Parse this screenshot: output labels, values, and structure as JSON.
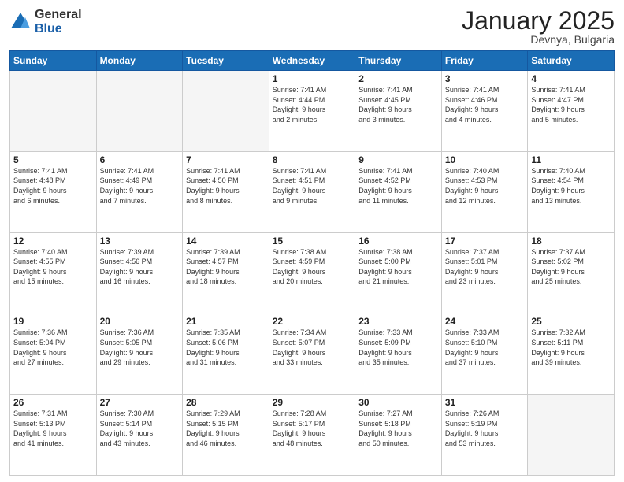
{
  "logo": {
    "general": "General",
    "blue": "Blue"
  },
  "header": {
    "month": "January 2025",
    "location": "Devnya, Bulgaria"
  },
  "weekdays": [
    "Sunday",
    "Monday",
    "Tuesday",
    "Wednesday",
    "Thursday",
    "Friday",
    "Saturday"
  ],
  "weeks": [
    [
      {
        "day": "",
        "info": ""
      },
      {
        "day": "",
        "info": ""
      },
      {
        "day": "",
        "info": ""
      },
      {
        "day": "1",
        "info": "Sunrise: 7:41 AM\nSunset: 4:44 PM\nDaylight: 9 hours\nand 2 minutes."
      },
      {
        "day": "2",
        "info": "Sunrise: 7:41 AM\nSunset: 4:45 PM\nDaylight: 9 hours\nand 3 minutes."
      },
      {
        "day": "3",
        "info": "Sunrise: 7:41 AM\nSunset: 4:46 PM\nDaylight: 9 hours\nand 4 minutes."
      },
      {
        "day": "4",
        "info": "Sunrise: 7:41 AM\nSunset: 4:47 PM\nDaylight: 9 hours\nand 5 minutes."
      }
    ],
    [
      {
        "day": "5",
        "info": "Sunrise: 7:41 AM\nSunset: 4:48 PM\nDaylight: 9 hours\nand 6 minutes."
      },
      {
        "day": "6",
        "info": "Sunrise: 7:41 AM\nSunset: 4:49 PM\nDaylight: 9 hours\nand 7 minutes."
      },
      {
        "day": "7",
        "info": "Sunrise: 7:41 AM\nSunset: 4:50 PM\nDaylight: 9 hours\nand 8 minutes."
      },
      {
        "day": "8",
        "info": "Sunrise: 7:41 AM\nSunset: 4:51 PM\nDaylight: 9 hours\nand 9 minutes."
      },
      {
        "day": "9",
        "info": "Sunrise: 7:41 AM\nSunset: 4:52 PM\nDaylight: 9 hours\nand 11 minutes."
      },
      {
        "day": "10",
        "info": "Sunrise: 7:40 AM\nSunset: 4:53 PM\nDaylight: 9 hours\nand 12 minutes."
      },
      {
        "day": "11",
        "info": "Sunrise: 7:40 AM\nSunset: 4:54 PM\nDaylight: 9 hours\nand 13 minutes."
      }
    ],
    [
      {
        "day": "12",
        "info": "Sunrise: 7:40 AM\nSunset: 4:55 PM\nDaylight: 9 hours\nand 15 minutes."
      },
      {
        "day": "13",
        "info": "Sunrise: 7:39 AM\nSunset: 4:56 PM\nDaylight: 9 hours\nand 16 minutes."
      },
      {
        "day": "14",
        "info": "Sunrise: 7:39 AM\nSunset: 4:57 PM\nDaylight: 9 hours\nand 18 minutes."
      },
      {
        "day": "15",
        "info": "Sunrise: 7:38 AM\nSunset: 4:59 PM\nDaylight: 9 hours\nand 20 minutes."
      },
      {
        "day": "16",
        "info": "Sunrise: 7:38 AM\nSunset: 5:00 PM\nDaylight: 9 hours\nand 21 minutes."
      },
      {
        "day": "17",
        "info": "Sunrise: 7:37 AM\nSunset: 5:01 PM\nDaylight: 9 hours\nand 23 minutes."
      },
      {
        "day": "18",
        "info": "Sunrise: 7:37 AM\nSunset: 5:02 PM\nDaylight: 9 hours\nand 25 minutes."
      }
    ],
    [
      {
        "day": "19",
        "info": "Sunrise: 7:36 AM\nSunset: 5:04 PM\nDaylight: 9 hours\nand 27 minutes."
      },
      {
        "day": "20",
        "info": "Sunrise: 7:36 AM\nSunset: 5:05 PM\nDaylight: 9 hours\nand 29 minutes."
      },
      {
        "day": "21",
        "info": "Sunrise: 7:35 AM\nSunset: 5:06 PM\nDaylight: 9 hours\nand 31 minutes."
      },
      {
        "day": "22",
        "info": "Sunrise: 7:34 AM\nSunset: 5:07 PM\nDaylight: 9 hours\nand 33 minutes."
      },
      {
        "day": "23",
        "info": "Sunrise: 7:33 AM\nSunset: 5:09 PM\nDaylight: 9 hours\nand 35 minutes."
      },
      {
        "day": "24",
        "info": "Sunrise: 7:33 AM\nSunset: 5:10 PM\nDaylight: 9 hours\nand 37 minutes."
      },
      {
        "day": "25",
        "info": "Sunrise: 7:32 AM\nSunset: 5:11 PM\nDaylight: 9 hours\nand 39 minutes."
      }
    ],
    [
      {
        "day": "26",
        "info": "Sunrise: 7:31 AM\nSunset: 5:13 PM\nDaylight: 9 hours\nand 41 minutes."
      },
      {
        "day": "27",
        "info": "Sunrise: 7:30 AM\nSunset: 5:14 PM\nDaylight: 9 hours\nand 43 minutes."
      },
      {
        "day": "28",
        "info": "Sunrise: 7:29 AM\nSunset: 5:15 PM\nDaylight: 9 hours\nand 46 minutes."
      },
      {
        "day": "29",
        "info": "Sunrise: 7:28 AM\nSunset: 5:17 PM\nDaylight: 9 hours\nand 48 minutes."
      },
      {
        "day": "30",
        "info": "Sunrise: 7:27 AM\nSunset: 5:18 PM\nDaylight: 9 hours\nand 50 minutes."
      },
      {
        "day": "31",
        "info": "Sunrise: 7:26 AM\nSunset: 5:19 PM\nDaylight: 9 hours\nand 53 minutes."
      },
      {
        "day": "",
        "info": ""
      }
    ]
  ]
}
